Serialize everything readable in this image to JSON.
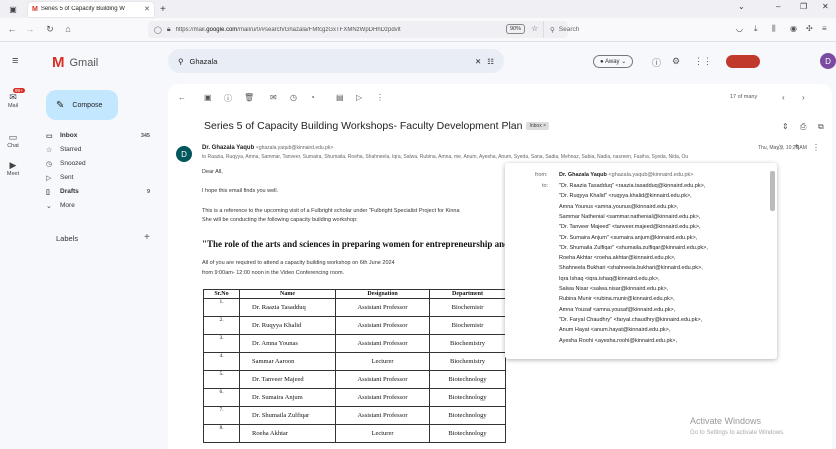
{
  "browser": {
    "tab_title": "Series 5 of Capacity Building W",
    "url_prefix": "https://mail.",
    "url_domain": "google.com",
    "url_rest": "/mail/u/0/#search/Ghazala/FMfcgzGxTFXMNzWpDHhDzpdvlt",
    "zoom": "90%",
    "search_placeholder": "Search"
  },
  "gmail": {
    "logo_text": "Gmail",
    "search_value": "Ghazala",
    "status": "Away",
    "avatar_letter": "D"
  },
  "rail": {
    "mail_badge": "99+",
    "mail": "Mail",
    "chat": "Chat",
    "meet": "Meet"
  },
  "sidebar": {
    "compose": "Compose",
    "folders": [
      {
        "label": "Inbox",
        "count": "345"
      },
      {
        "label": "Starred",
        "count": ""
      },
      {
        "label": "Snoozed",
        "count": ""
      },
      {
        "label": "Sent",
        "count": ""
      },
      {
        "label": "Drafts",
        "count": "9"
      },
      {
        "label": "More",
        "count": ""
      }
    ],
    "labels_heading": "Labels"
  },
  "email": {
    "pager": "17 of many",
    "subject": "Series 5 of Capacity Building Workshops- Faculty Development Plan",
    "inbox_chip": "Inbox ×",
    "sender_avatar": "D",
    "sender_name": "Dr. Ghazala Yaqub",
    "sender_email": "<ghazala.yaqub@kinnaird.edu.pk>",
    "to_line": "to Raazia, Ruqyya, Amna, Sammar, Tanveer, Sumaira, Shumaila, Roeha, Shahneela, Iqra, Salwa, Rubina, Amna, me, Anum, Ayesha, Anum, Syeda, Sana, Sadia, Mehnaz, Sabia, Nadia, nasreen, Fasiha, Syeda, Nida, Ou",
    "date": "Thu, May 9, 10:26 AM",
    "greeting": "Dear All,",
    "line1": "I hope this email finds you well.",
    "line2": "This is a reference to the upcoming visit of a Fulbright scholar under \"Fulbright Specialist Project for Kinna",
    "line3": "She will be conducting the following capacity building workshop:",
    "headline": "\"The role of the arts and sciences in preparing women for entrepreneurship and financial",
    "line4": "All of you are required to attend a capacity building workshop on 6th June 2024",
    "line5": "from 9:00am- 12:00 noon in the Video Conferencing room.",
    "table_headers": [
      "Sr.No",
      "Name",
      "Designation",
      "Department"
    ],
    "table_rows": [
      {
        "sn": "1.",
        "name": "Dr. Raazia Tasadduq",
        "designation": "Assistant Professor",
        "department": "Biochemistr"
      },
      {
        "sn": "2.",
        "name": "Dr. Ruqyya Khalid",
        "designation": "Assistant Professor",
        "department": "Biochemistr"
      },
      {
        "sn": "3.",
        "name": "Dr. Amna Younas",
        "designation": "Assistant Professor",
        "department": "Biochemistry"
      },
      {
        "sn": "4.",
        "name": "Sammar Aaroon",
        "designation": "Lecturer",
        "department": "Biochemistry"
      },
      {
        "sn": "5.",
        "name": "Dr. Tanveer Majeed",
        "designation": "Assistant Professor",
        "department": "Biotechnology"
      },
      {
        "sn": "6.",
        "name": "Dr. Sumaira Anjum",
        "designation": "Assistant Professor",
        "department": "Biotechnology"
      },
      {
        "sn": "7.",
        "name": "Dr. Shumaila Zulfiqar",
        "designation": "Assistant Professor",
        "department": "Biotechnology"
      },
      {
        "sn": "8.",
        "name": "Roeha Akhtar",
        "designation": "Lecturer",
        "department": "Biotechnology"
      }
    ]
  },
  "popover": {
    "from_label": "from:",
    "from_name": "Dr. Ghazala Yaqub",
    "from_email": "<ghazala.yaqub@kinnaird.edu.pk>",
    "to_label": "to:",
    "recipients": [
      "\"Dr. Raazia Tasadduq\" <raazia.tasadduq@kinnaird.edu.pk>,",
      "\"Dr. Ruqyya Khalid\" <ruqyya.khalid@kinnaird.edu.pk>,",
      "Amna Younus <amna.younus@kinnaird.edu.pk>,",
      "Sammar Nathenial <sammar.nathenial@kinnaird.edu.pk>,",
      "\"Dr. Tanveer Majeed\" <tanveer.majeed@kinnaird.edu.pk>,",
      "\"Dr. Sumaira Anjum\" <sumaira.anjum@kinnaird.edu.pk>,",
      "\"Dr. Shumaila Zulfiqar\" <shumaila.zulfiqar@kinnaird.edu.pk>,",
      "Roeha Akhtar <roeha.akhtar@kinnaird.edu.pk>,",
      "Shahneela Bukhari <shahneela.bukhari@kinnaird.edu.pk>,",
      "Iqra Ishaq <iqra.ishaq@kinnaird.edu.pk>,",
      "Salwa Nisar <salwa.nisar@kinnaird.edu.pk>,",
      "Rubina Munir <rubina.munir@kinnaird.edu.pk>,",
      "Amna Yousaf <amna.yousaf@kinnaird.edu.pk>,",
      "\"Dr. Faryal Chaudhry\" <faryal.chaudhry@kinnaird.edu.pk>,",
      "Anum Hayat <anum.hayat@kinnaird.edu.pk>,",
      "Ayesha Roohi <ayesha.roohi@kinnaird.edu.pk>,"
    ]
  },
  "watermark": {
    "title": "Activate Windows",
    "sub": "Go to Settings to activate Windows."
  }
}
